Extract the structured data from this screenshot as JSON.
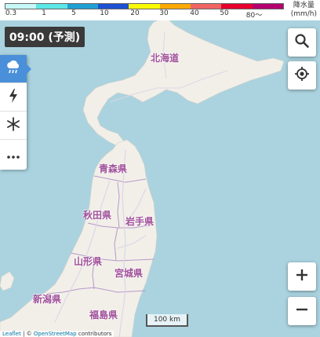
{
  "legend": {
    "colors": [
      "#c8f7f7",
      "#5ce6e6",
      "#1ea0d2",
      "#1e50d2",
      "#fafa00",
      "#faaa00",
      "#f06464",
      "#e6002d",
      "#b4006e"
    ],
    "labels": [
      "0.3",
      "1",
      "5",
      "10",
      "20",
      "30",
      "40",
      "50",
      "80～"
    ],
    "title": "降水量",
    "unit": "(mm/h)"
  },
  "time_badge": "09:00 (予測)",
  "side_menu": {
    "items": [
      {
        "icon": "rain-cloud-icon",
        "active": true
      },
      {
        "icon": "lightning-icon",
        "active": false
      },
      {
        "icon": "snowflake-icon",
        "active": false
      },
      {
        "icon": "more-dots-icon",
        "active": false
      }
    ]
  },
  "map": {
    "regions": [
      "北海道",
      "青森県",
      "秋田県",
      "岩手県",
      "山形県",
      "宮城県",
      "新潟県",
      "福島県"
    ],
    "colors": {
      "sea": "#aad3df",
      "land": "#f2efe9",
      "border": "#b59ac8",
      "road": "#e8e0f0"
    }
  },
  "scale": "100 km",
  "attribution": {
    "leaflet": "Leaflet",
    "separator": " | © ",
    "osm": "OpenStreetMap",
    "contributors": " contributors"
  }
}
